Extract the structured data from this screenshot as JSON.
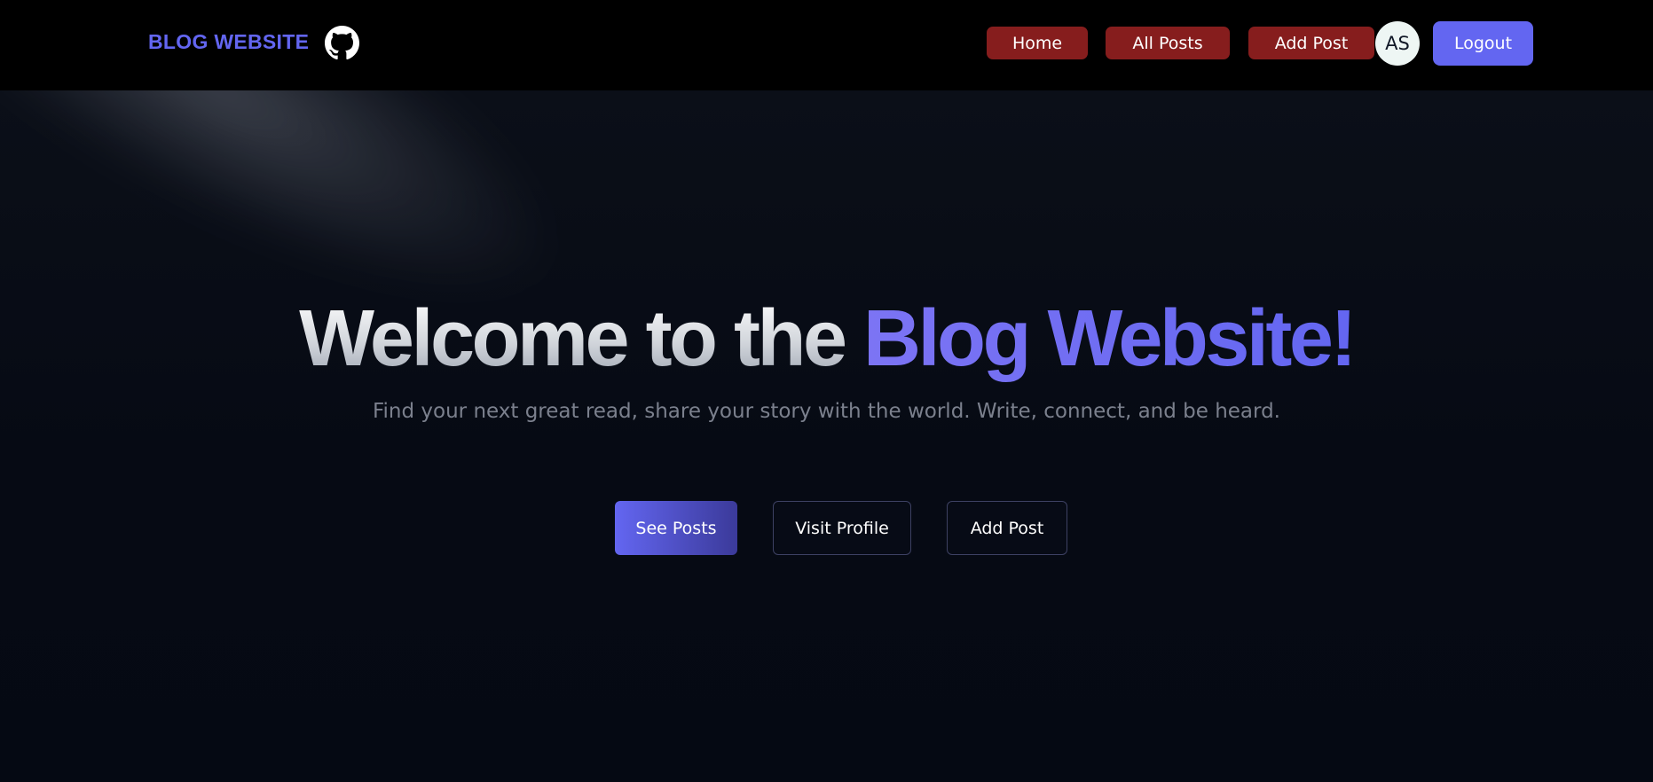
{
  "navbar": {
    "brand": "BLOG WEBSITE",
    "github_icon": "github-icon",
    "links": [
      "Home",
      "All Posts",
      "Add Post"
    ],
    "avatar_initials": "AS",
    "logout_label": "Logout"
  },
  "hero": {
    "headline_plain": "Welcome to the",
    "headline_accent": "Blog Website!",
    "tagline": "Find your next great read, share your story with the world. Write, connect, and be heard.",
    "buttons": {
      "see_posts": "See Posts",
      "visit_profile": "Visit Profile",
      "add_post": "Add Post"
    }
  },
  "colors": {
    "accent": "#6366f1",
    "nav_link_bg": "#861d1d",
    "navbar_bg": "#000000",
    "page_bg": "#030712"
  }
}
